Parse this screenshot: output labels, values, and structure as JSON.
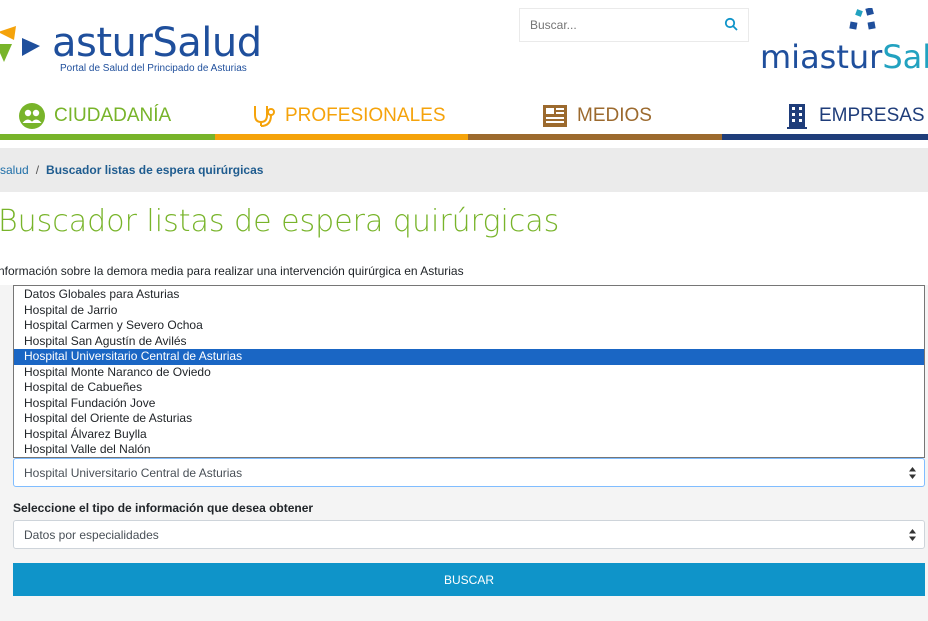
{
  "header": {
    "logo_text": "asturSalud",
    "logo_tagline": "Portal de Salud del Principado de Asturias",
    "search_placeholder": "Buscar...",
    "mias_logo_part1": "miastur",
    "mias_logo_part2": "Salud"
  },
  "nav": {
    "items": [
      {
        "label": "CIUDADANÍA",
        "color": "#78b42a",
        "icon": "people-icon"
      },
      {
        "label": "PROFESIONALES",
        "color": "#f5a30b",
        "icon": "stethoscope-icon"
      },
      {
        "label": "MEDIOS",
        "color": "#9c6a2e",
        "icon": "newspaper-icon"
      },
      {
        "label": "EMPRESAS",
        "color": "#1f3d7a",
        "icon": "building-icon"
      }
    ]
  },
  "breadcrumb": {
    "home": "salud",
    "separator": "/",
    "current": "Buscador listas de espera quirúrgicas"
  },
  "page": {
    "title": "Buscador listas de espera quirúrgicas",
    "intro": "nformación sobre la demora media para realizar una intervención quirúrgica en Asturias"
  },
  "form": {
    "hospital_selected": "Hospital Universitario Central de Asturias",
    "hospital_options": [
      "Datos Globales para Asturias",
      "Hospital de Jarrio",
      "Hospital Carmen y Severo Ochoa",
      "Hospital San Agustín de Avilés",
      "Hospital Universitario Central de Asturias",
      "Hospital Monte Naranco de Oviedo",
      "Hospital de Cabueñes",
      "Hospital Fundación Jove",
      "Hospital del Oriente de Asturias",
      "Hospital Álvarez Buylla",
      "Hospital Valle del Nalón"
    ],
    "selected_index": 4,
    "info_type_label": "Seleccione el tipo de información que desea obtener",
    "info_type_selected": "Datos por especialidades",
    "submit_label": "BUSCAR"
  },
  "colors": {
    "accent_blue": "#0f94c9",
    "title_green": "#78b42a",
    "brand_blue": "#1f4f9c"
  }
}
